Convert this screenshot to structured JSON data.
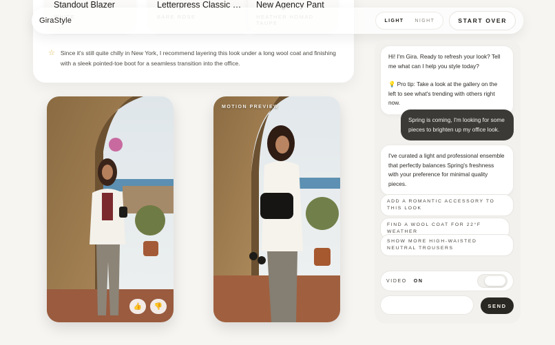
{
  "app": {
    "brand": "GiraStyle"
  },
  "header": {
    "theme_options": [
      "LIGHT",
      "NIGHT"
    ],
    "theme_selected": "LIGHT",
    "start_over_label": "START OVER"
  },
  "products": [
    {
      "name": "Standout Blazer",
      "color": "WHITE"
    },
    {
      "name": "Letterpress Classic Po...",
      "color": "BARE ROSE"
    },
    {
      "name": "New Agency Pant",
      "color": "HEATHER HOMAD TAUPE"
    }
  ],
  "tip": {
    "icon": "star-icon",
    "text": "Since it's still quite chilly in New York, I recommend layering this look under a long wool coat and finishing with a sleek pointed-toe boot for a seamless transition into the office."
  },
  "gallery": {
    "motion_label": "MOTION PREVIEW",
    "like_icon": "thumbs-up-icon",
    "dislike_icon": "thumbs-down-icon"
  },
  "chat": {
    "messages": [
      {
        "role": "ai",
        "paras": [
          "Hi! I'm Gira. Ready to refresh your look? Tell me what can I help you style today?",
          "💡 Pro tip: Take a look at the gallery on the left to see what's trending with others right now."
        ]
      },
      {
        "role": "user",
        "paras": [
          "Spring is coming, I'm looking for some pieces to brighten up my office look."
        ]
      },
      {
        "role": "ai",
        "paras": [
          "I've curated a light and professional ensemble that perfectly balances Spring's freshness with your preference for minimal quality pieces."
        ]
      }
    ],
    "suggestions": [
      "ADD A ROMANTIC ACCESSORY TO THIS LOOK",
      "FIND A WOOL COAT FOR 22°F WEATHER",
      "SHOW MORE HIGH-WAISTED NEUTRAL TROUSERS"
    ],
    "video_label": "VIDEO",
    "video_state": "ON",
    "input_value": "",
    "send_label": "SEND"
  },
  "colors": {
    "accent_dark": "#2a2823",
    "star": "#d9b24a",
    "background": "#f6f5f2"
  }
}
